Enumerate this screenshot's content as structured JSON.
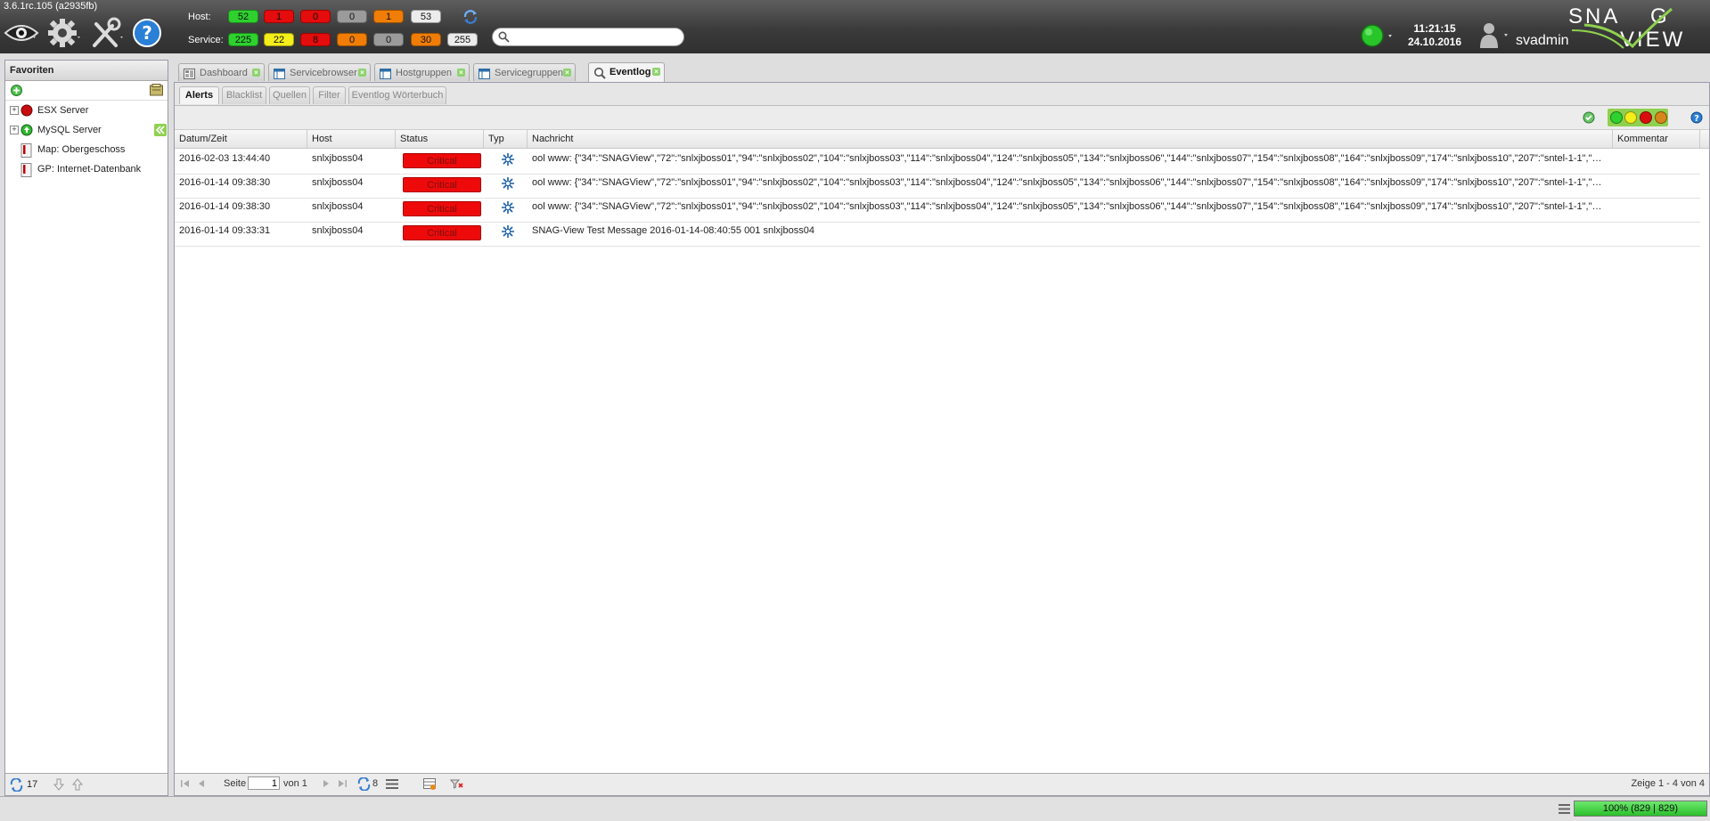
{
  "app": {
    "version": "3.6.1rc.105 (a2935fb)",
    "logo": "SNAG VIEW",
    "time": "11:21:15",
    "date": "24.10.2016",
    "user": "svadmin",
    "search_placeholder": ""
  },
  "summary": {
    "host_label": "Host:",
    "service_label": "Service:",
    "host": [
      "52",
      "1",
      "0",
      "0",
      "1",
      "53"
    ],
    "service": [
      "225",
      "22",
      "8",
      "0",
      "0",
      "30",
      "255"
    ]
  },
  "favorites": {
    "title": "Favoriten",
    "items": [
      {
        "label": "ESX Server",
        "status": "critical"
      },
      {
        "label": "MySQL Server",
        "status": "ok"
      },
      {
        "label": "Map: Obergeschoss",
        "status": "map"
      },
      {
        "label": "GP: Internet-Datenbank",
        "status": "map"
      }
    ],
    "refresh_count": "17"
  },
  "tabs": [
    {
      "label": "Dashboard"
    },
    {
      "label": "Servicebrowser"
    },
    {
      "label": "Hostgruppen"
    },
    {
      "label": "Servicegruppen"
    },
    {
      "label": "Eventlog"
    }
  ],
  "subtabs": [
    "Alerts",
    "Blacklist",
    "Quellen",
    "Filter",
    "Eventlog Wörterbuch"
  ],
  "table": {
    "columns": [
      "Datum/Zeit",
      "Host",
      "Status",
      "Typ",
      "Nachricht",
      "Kommentar"
    ],
    "rows": [
      {
        "datetime": "2016-02-03 13:44:40",
        "host": "snlxjboss04",
        "status": "Critical",
        "message": "ool www: {\"34\":\"SNAGView\",\"72\":\"snlxjboss01\",\"94\":\"snlxjboss02\",\"104\":\"snlxjboss03\",\"114\":\"snlxjboss04\",\"124\":\"snlxjboss05\",\"134\":\"snlxjboss06\",\"144\":\"snlxjboss07\",\"154\":\"snlxjboss08\",\"164\":\"snlxjboss09\",\"174\":\"snlxjboss10\",\"207\":\"sntel-1-1\",\"…",
        "comment": ""
      },
      {
        "datetime": "2016-01-14 09:38:30",
        "host": "snlxjboss04",
        "status": "Critical",
        "message": "ool www: {\"34\":\"SNAGView\",\"72\":\"snlxjboss01\",\"94\":\"snlxjboss02\",\"104\":\"snlxjboss03\",\"114\":\"snlxjboss04\",\"124\":\"snlxjboss05\",\"134\":\"snlxjboss06\",\"144\":\"snlxjboss07\",\"154\":\"snlxjboss08\",\"164\":\"snlxjboss09\",\"174\":\"snlxjboss10\",\"207\":\"sntel-1-1\",\"…",
        "comment": ""
      },
      {
        "datetime": "2016-01-14 09:38:30",
        "host": "snlxjboss04",
        "status": "Critical",
        "message": "ool www: {\"34\":\"SNAGView\",\"72\":\"snlxjboss01\",\"94\":\"snlxjboss02\",\"104\":\"snlxjboss03\",\"114\":\"snlxjboss04\",\"124\":\"snlxjboss05\",\"134\":\"snlxjboss06\",\"144\":\"snlxjboss07\",\"154\":\"snlxjboss08\",\"164\":\"snlxjboss09\",\"174\":\"snlxjboss10\",\"207\":\"sntel-1-1\",\"…",
        "comment": ""
      },
      {
        "datetime": "2016-01-14 09:33:31",
        "host": "snlxjboss04",
        "status": "Critical",
        "message": "SNAG-View Test Message 2016-01-14-08:40:55 001 snlxjboss04",
        "comment": ""
      }
    ]
  },
  "pager": {
    "page_label": "Seite",
    "page": "1",
    "of_label": "von 1",
    "refresh_count": "8",
    "display": "Zeige 1 - 4 von 4"
  },
  "statusbar": {
    "memory": "100% (829 | 829)"
  },
  "colors": {
    "ok": "#2ed12e",
    "warning": "#f4ee1a",
    "critical": "#e40c0c",
    "unknown": "#ef7d06",
    "pending": "#9b9b9b",
    "accent": "#8fd14f"
  }
}
